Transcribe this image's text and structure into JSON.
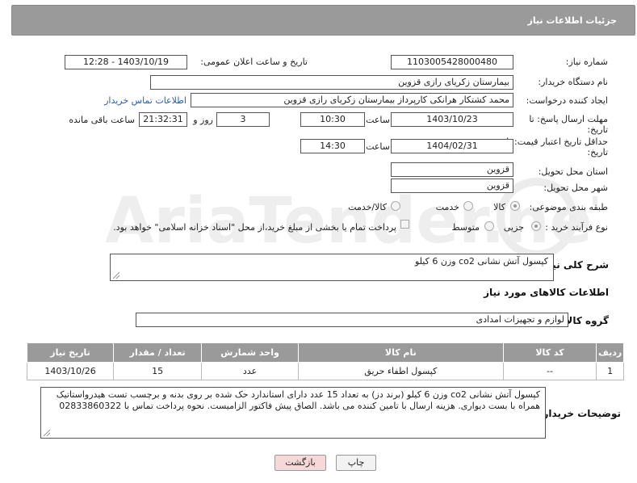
{
  "header": {
    "title": "جزئیات اطلاعات نیاز"
  },
  "labels": {
    "need_number": "شماره نیاز:",
    "announce_datetime": "تاریخ و ساعت اعلان عمومی:",
    "buyer_org": "نام دستگاه خریدار:",
    "requester": "ایجاد کننده درخواست:",
    "contact_link": "اطلاعات تماس خریدار",
    "deadline_send": "مهلت ارسال پاسخ: تا",
    "deadline_date": "تاریخ:",
    "time": "ساعت",
    "days": "روز و",
    "hours_left": "ساعت باقی مانده",
    "price_validity": "حداقل تاریخ اعتبار قیمت: تا",
    "price_validity_date": "تاریخ:",
    "time2": "ساعت",
    "province": "استان محل تحویل:",
    "city": "شهر محل تحویل:",
    "category": "طبقه بندی موضوعی:",
    "purchase_type": "نوع فرآیند خرید :",
    "general_desc": "شرح کلی نیاز:",
    "goods_info": "اطلاعات کالاهای مورد نیاز",
    "goods_group": "گروه کالا:",
    "buyer_notes": "توضیحات خریدار:"
  },
  "values": {
    "need_number": "1103005428000480",
    "announce_datetime": "1403/10/19 - 12:28",
    "buyer_org": "بیمارستان زکریای رازی قزوین",
    "requester": "محمد کشتکار هرانکی کارپرداز بیمارستان زکریای رازی قزوین",
    "deadline_date": "1403/10/23",
    "deadline_time": "10:30",
    "days": "3",
    "remaining": "21:32:31",
    "validity_date": "1404/02/31",
    "validity_time": "14:30",
    "province": "قزوین",
    "city": "قزوین",
    "general_desc": "کپسول آتش نشانی co2 وزن 6 کیلو",
    "goods_group": "لوازم و تجهیزات امدادی",
    "buyer_notes": "کپسول آتش نشانی co2 وزن 6 کیلو (برند دز) به تعداد 15 عدد دارای استاندارد حک شده بر روی بدنه و برچسب تست هیدرواستاتیک همراه با بست دیواری. هزینه ارسال با تامین کننده می باشد. الصاق پیش فاکتور الزامیست. نحوه پرداخت تماس با 02833860322"
  },
  "category_options": [
    {
      "label": "کالا",
      "selected": true
    },
    {
      "label": "خدمت",
      "selected": false
    },
    {
      "label": "کالا/خدمت",
      "selected": false
    }
  ],
  "purchase_options": [
    {
      "label": "جزیی",
      "selected": true
    },
    {
      "label": "متوسط",
      "selected": false
    }
  ],
  "payment_note": "پرداخت تمام یا بخشی از مبلغ خرید،از محل \"اسناد خزانه اسلامی\" خواهد بود.",
  "table": {
    "headers": [
      "ردیف",
      "کد کالا",
      "نام کالا",
      "واحد شمارش",
      "تعداد / مقدار",
      "تاریخ نیاز"
    ],
    "rows": [
      [
        "1",
        "--",
        "کپسول اطفاء حریق",
        "عدد",
        "15",
        "1403/10/26"
      ]
    ]
  },
  "buttons": {
    "print": "چاپ",
    "back": "بازگشت"
  },
  "watermark": "AriaTender.neT",
  "colors": {
    "header_bg": "#9a9a9a",
    "link": "#2a5db0",
    "back_btn": "#f6d8d8",
    "print_btn": "#f2f2f2"
  }
}
